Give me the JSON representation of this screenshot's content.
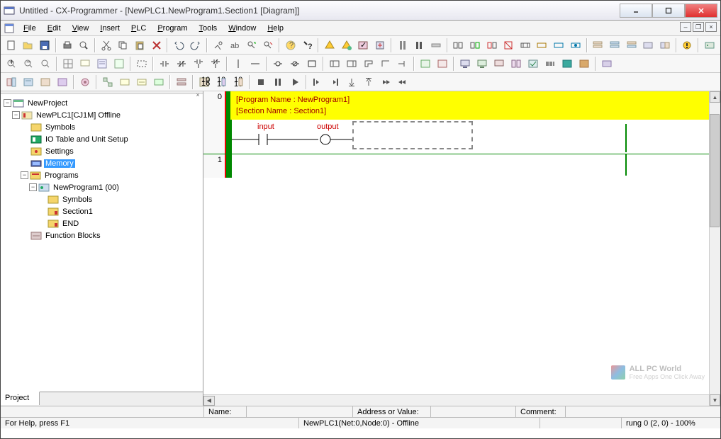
{
  "window": {
    "title": "Untitled - CX-Programmer - [NewPLC1.NewProgram1.Section1 [Diagram]]"
  },
  "menu": {
    "items": [
      "File",
      "Edit",
      "View",
      "Insert",
      "PLC",
      "Program",
      "Tools",
      "Window",
      "Help"
    ]
  },
  "tree": {
    "root": "NewProject",
    "plc": "NewPLC1[CJ1M] Offline",
    "nodes": {
      "symbols": "Symbols",
      "io_table": "IO Table and Unit Setup",
      "settings": "Settings",
      "memory": "Memory",
      "programs": "Programs",
      "program1": "NewProgram1 (00)",
      "prog_symbols": "Symbols",
      "section1": "Section1",
      "end": "END",
      "function_blocks": "Function Blocks"
    }
  },
  "left_tab": "Project",
  "ladder": {
    "rung0": "0",
    "rung0b": "0",
    "rung1": "1",
    "program_name": "[Program Name : NewProgram1]",
    "section_name": "[Section Name : Section1]",
    "input_label": "input",
    "output_label": "output"
  },
  "fields": {
    "name_label": "Name:",
    "name_value": "",
    "addr_label": "Address or Value:",
    "addr_value": "",
    "comment_label": "Comment:",
    "comment_value": ""
  },
  "status": {
    "help": "For Help, press F1",
    "connection": "NewPLC1(Net:0,Node:0) - Offline",
    "rung_info": "rung 0 (2, 0)  - 100%"
  },
  "watermark": {
    "title": "ALL PC World",
    "subtitle": "Free Apps One Click Away"
  }
}
